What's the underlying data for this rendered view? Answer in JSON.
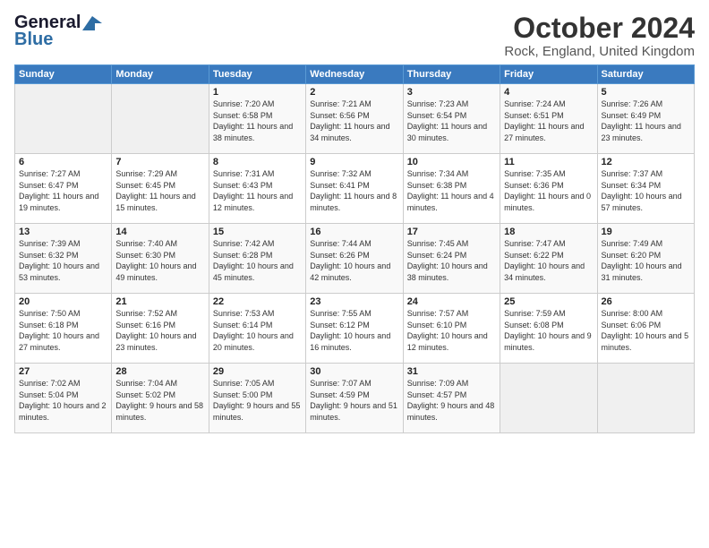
{
  "logo": {
    "line1": "General",
    "line2": "Blue"
  },
  "title": "October 2024",
  "subtitle": "Rock, England, United Kingdom",
  "weekdays": [
    "Sunday",
    "Monday",
    "Tuesday",
    "Wednesday",
    "Thursday",
    "Friday",
    "Saturday"
  ],
  "weeks": [
    [
      {
        "day": "",
        "sunrise": "",
        "sunset": "",
        "daylight": ""
      },
      {
        "day": "",
        "sunrise": "",
        "sunset": "",
        "daylight": ""
      },
      {
        "day": "1",
        "sunrise": "Sunrise: 7:20 AM",
        "sunset": "Sunset: 6:58 PM",
        "daylight": "Daylight: 11 hours and 38 minutes."
      },
      {
        "day": "2",
        "sunrise": "Sunrise: 7:21 AM",
        "sunset": "Sunset: 6:56 PM",
        "daylight": "Daylight: 11 hours and 34 minutes."
      },
      {
        "day": "3",
        "sunrise": "Sunrise: 7:23 AM",
        "sunset": "Sunset: 6:54 PM",
        "daylight": "Daylight: 11 hours and 30 minutes."
      },
      {
        "day": "4",
        "sunrise": "Sunrise: 7:24 AM",
        "sunset": "Sunset: 6:51 PM",
        "daylight": "Daylight: 11 hours and 27 minutes."
      },
      {
        "day": "5",
        "sunrise": "Sunrise: 7:26 AM",
        "sunset": "Sunset: 6:49 PM",
        "daylight": "Daylight: 11 hours and 23 minutes."
      }
    ],
    [
      {
        "day": "6",
        "sunrise": "Sunrise: 7:27 AM",
        "sunset": "Sunset: 6:47 PM",
        "daylight": "Daylight: 11 hours and 19 minutes."
      },
      {
        "day": "7",
        "sunrise": "Sunrise: 7:29 AM",
        "sunset": "Sunset: 6:45 PM",
        "daylight": "Daylight: 11 hours and 15 minutes."
      },
      {
        "day": "8",
        "sunrise": "Sunrise: 7:31 AM",
        "sunset": "Sunset: 6:43 PM",
        "daylight": "Daylight: 11 hours and 12 minutes."
      },
      {
        "day": "9",
        "sunrise": "Sunrise: 7:32 AM",
        "sunset": "Sunset: 6:41 PM",
        "daylight": "Daylight: 11 hours and 8 minutes."
      },
      {
        "day": "10",
        "sunrise": "Sunrise: 7:34 AM",
        "sunset": "Sunset: 6:38 PM",
        "daylight": "Daylight: 11 hours and 4 minutes."
      },
      {
        "day": "11",
        "sunrise": "Sunrise: 7:35 AM",
        "sunset": "Sunset: 6:36 PM",
        "daylight": "Daylight: 11 hours and 0 minutes."
      },
      {
        "day": "12",
        "sunrise": "Sunrise: 7:37 AM",
        "sunset": "Sunset: 6:34 PM",
        "daylight": "Daylight: 10 hours and 57 minutes."
      }
    ],
    [
      {
        "day": "13",
        "sunrise": "Sunrise: 7:39 AM",
        "sunset": "Sunset: 6:32 PM",
        "daylight": "Daylight: 10 hours and 53 minutes."
      },
      {
        "day": "14",
        "sunrise": "Sunrise: 7:40 AM",
        "sunset": "Sunset: 6:30 PM",
        "daylight": "Daylight: 10 hours and 49 minutes."
      },
      {
        "day": "15",
        "sunrise": "Sunrise: 7:42 AM",
        "sunset": "Sunset: 6:28 PM",
        "daylight": "Daylight: 10 hours and 45 minutes."
      },
      {
        "day": "16",
        "sunrise": "Sunrise: 7:44 AM",
        "sunset": "Sunset: 6:26 PM",
        "daylight": "Daylight: 10 hours and 42 minutes."
      },
      {
        "day": "17",
        "sunrise": "Sunrise: 7:45 AM",
        "sunset": "Sunset: 6:24 PM",
        "daylight": "Daylight: 10 hours and 38 minutes."
      },
      {
        "day": "18",
        "sunrise": "Sunrise: 7:47 AM",
        "sunset": "Sunset: 6:22 PM",
        "daylight": "Daylight: 10 hours and 34 minutes."
      },
      {
        "day": "19",
        "sunrise": "Sunrise: 7:49 AM",
        "sunset": "Sunset: 6:20 PM",
        "daylight": "Daylight: 10 hours and 31 minutes."
      }
    ],
    [
      {
        "day": "20",
        "sunrise": "Sunrise: 7:50 AM",
        "sunset": "Sunset: 6:18 PM",
        "daylight": "Daylight: 10 hours and 27 minutes."
      },
      {
        "day": "21",
        "sunrise": "Sunrise: 7:52 AM",
        "sunset": "Sunset: 6:16 PM",
        "daylight": "Daylight: 10 hours and 23 minutes."
      },
      {
        "day": "22",
        "sunrise": "Sunrise: 7:53 AM",
        "sunset": "Sunset: 6:14 PM",
        "daylight": "Daylight: 10 hours and 20 minutes."
      },
      {
        "day": "23",
        "sunrise": "Sunrise: 7:55 AM",
        "sunset": "Sunset: 6:12 PM",
        "daylight": "Daylight: 10 hours and 16 minutes."
      },
      {
        "day": "24",
        "sunrise": "Sunrise: 7:57 AM",
        "sunset": "Sunset: 6:10 PM",
        "daylight": "Daylight: 10 hours and 12 minutes."
      },
      {
        "day": "25",
        "sunrise": "Sunrise: 7:59 AM",
        "sunset": "Sunset: 6:08 PM",
        "daylight": "Daylight: 10 hours and 9 minutes."
      },
      {
        "day": "26",
        "sunrise": "Sunrise: 8:00 AM",
        "sunset": "Sunset: 6:06 PM",
        "daylight": "Daylight: 10 hours and 5 minutes."
      }
    ],
    [
      {
        "day": "27",
        "sunrise": "Sunrise: 7:02 AM",
        "sunset": "Sunset: 5:04 PM",
        "daylight": "Daylight: 10 hours and 2 minutes."
      },
      {
        "day": "28",
        "sunrise": "Sunrise: 7:04 AM",
        "sunset": "Sunset: 5:02 PM",
        "daylight": "Daylight: 9 hours and 58 minutes."
      },
      {
        "day": "29",
        "sunrise": "Sunrise: 7:05 AM",
        "sunset": "Sunset: 5:00 PM",
        "daylight": "Daylight: 9 hours and 55 minutes."
      },
      {
        "day": "30",
        "sunrise": "Sunrise: 7:07 AM",
        "sunset": "Sunset: 4:59 PM",
        "daylight": "Daylight: 9 hours and 51 minutes."
      },
      {
        "day": "31",
        "sunrise": "Sunrise: 7:09 AM",
        "sunset": "Sunset: 4:57 PM",
        "daylight": "Daylight: 9 hours and 48 minutes."
      },
      {
        "day": "",
        "sunrise": "",
        "sunset": "",
        "daylight": ""
      },
      {
        "day": "",
        "sunrise": "",
        "sunset": "",
        "daylight": ""
      }
    ]
  ]
}
